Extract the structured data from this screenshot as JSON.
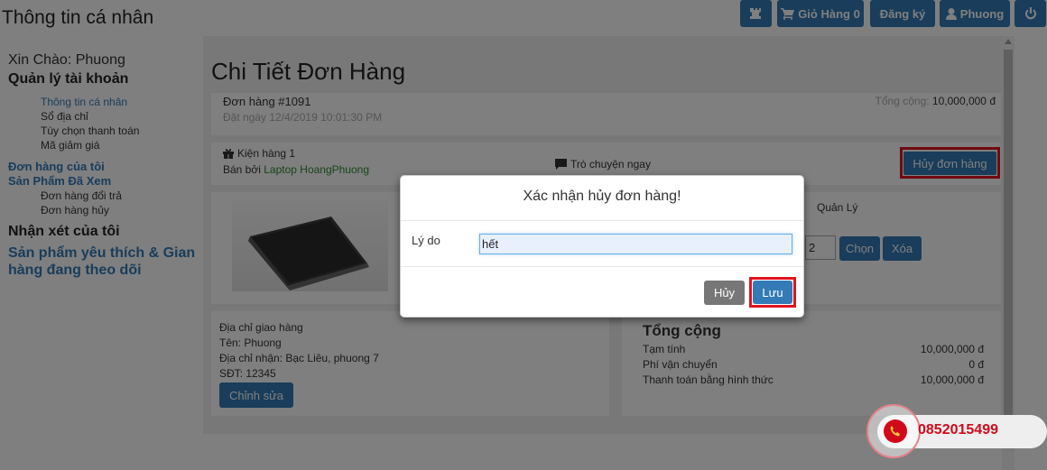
{
  "header": {
    "page_title": "Thông tin cá nhân",
    "cart_label": "Giỏ Hàng 0",
    "register_label": "Đăng ký",
    "user_label": "Phuong"
  },
  "sidebar": {
    "greeting": "Xin Chào: Phuong",
    "account_title": "Quản lý tài khoản",
    "account_items": [
      "Thông tin cá nhân",
      "Sổ địa chỉ",
      "Tùy chọn thanh toán",
      "Mã giảm giá"
    ],
    "orders_link": "Đơn hàng của tôi",
    "viewed_link": "Sản Phẩm Đã Xem",
    "order_items": [
      "Đơn hàng đổi trả",
      "Đơn hàng hủy"
    ],
    "reviews_title": "Nhận xét của tôi",
    "favorites": "Sản phẩm yêu thích & Gian hàng đang theo dõi"
  },
  "order": {
    "title": "Chi Tiết Đơn Hàng",
    "number": "Đơn hàng #1091",
    "date": "Đặt ngày 12/4/2019 10:01:30 PM",
    "total_label": "Tổng cộng:",
    "total_value": "10,000,000 đ",
    "package": "Kiện hàng 1",
    "seller_prefix": "Bán bởi",
    "seller_name": "Laptop HoangPhuong",
    "chat": "Trò chuyện ngay",
    "cancel_order": "Hủy đơn hàng",
    "manage_label": "Quản Lý",
    "quantity": "2",
    "choose_btn": "Chọn",
    "delete_btn": "Xóa"
  },
  "address": {
    "title": "Địa chỉ giao hàng",
    "name": "Tên: Phuong",
    "addr": "Địa chỉ nhận: Bạc Liêu, phuong 7",
    "phone": "SĐT: 12345",
    "edit_btn": "Chỉnh sửa"
  },
  "summary": {
    "title": "Tổng cộng",
    "rows": [
      {
        "label": "Tạm tính",
        "value": "10,000,000 đ"
      },
      {
        "label": "Phí vận chuyển",
        "value": "0 đ"
      },
      {
        "label": "Thanh toán bằng hình thức",
        "value": "10,000,000 đ"
      }
    ]
  },
  "modal": {
    "title": "Xác nhận hủy đơn hàng!",
    "reason_label": "Lý do",
    "reason_value": "hết",
    "cancel_btn": "Hủy",
    "save_btn": "Lưu"
  },
  "hotline": "0852015499",
  "colors": {
    "primary": "#337ab7",
    "highlight": "#e0141e",
    "seller_green": "#2e8b2e",
    "hotline_red": "#d10a1b"
  }
}
